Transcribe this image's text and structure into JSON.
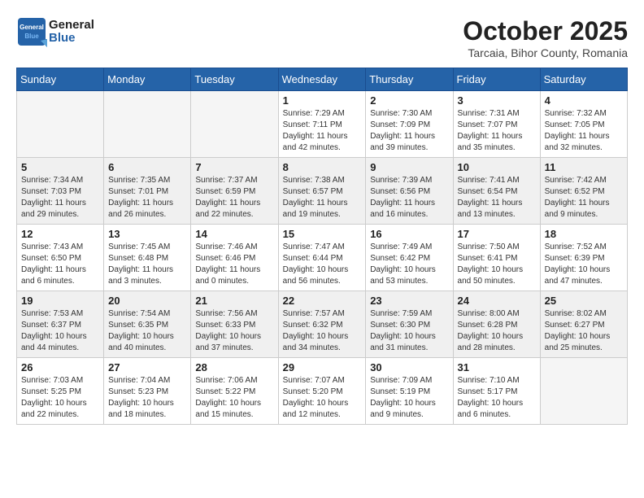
{
  "header": {
    "logo_general": "General",
    "logo_blue": "Blue",
    "month_title": "October 2025",
    "subtitle": "Tarcaia, Bihor County, Romania"
  },
  "weekdays": [
    "Sunday",
    "Monday",
    "Tuesday",
    "Wednesday",
    "Thursday",
    "Friday",
    "Saturday"
  ],
  "weeks": [
    [
      {
        "day": "",
        "info": ""
      },
      {
        "day": "",
        "info": ""
      },
      {
        "day": "",
        "info": ""
      },
      {
        "day": "1",
        "info": "Sunrise: 7:29 AM\nSunset: 7:11 PM\nDaylight: 11 hours\nand 42 minutes."
      },
      {
        "day": "2",
        "info": "Sunrise: 7:30 AM\nSunset: 7:09 PM\nDaylight: 11 hours\nand 39 minutes."
      },
      {
        "day": "3",
        "info": "Sunrise: 7:31 AM\nSunset: 7:07 PM\nDaylight: 11 hours\nand 35 minutes."
      },
      {
        "day": "4",
        "info": "Sunrise: 7:32 AM\nSunset: 7:05 PM\nDaylight: 11 hours\nand 32 minutes."
      }
    ],
    [
      {
        "day": "5",
        "info": "Sunrise: 7:34 AM\nSunset: 7:03 PM\nDaylight: 11 hours\nand 29 minutes."
      },
      {
        "day": "6",
        "info": "Sunrise: 7:35 AM\nSunset: 7:01 PM\nDaylight: 11 hours\nand 26 minutes."
      },
      {
        "day": "7",
        "info": "Sunrise: 7:37 AM\nSunset: 6:59 PM\nDaylight: 11 hours\nand 22 minutes."
      },
      {
        "day": "8",
        "info": "Sunrise: 7:38 AM\nSunset: 6:57 PM\nDaylight: 11 hours\nand 19 minutes."
      },
      {
        "day": "9",
        "info": "Sunrise: 7:39 AM\nSunset: 6:56 PM\nDaylight: 11 hours\nand 16 minutes."
      },
      {
        "day": "10",
        "info": "Sunrise: 7:41 AM\nSunset: 6:54 PM\nDaylight: 11 hours\nand 13 minutes."
      },
      {
        "day": "11",
        "info": "Sunrise: 7:42 AM\nSunset: 6:52 PM\nDaylight: 11 hours\nand 9 minutes."
      }
    ],
    [
      {
        "day": "12",
        "info": "Sunrise: 7:43 AM\nSunset: 6:50 PM\nDaylight: 11 hours\nand 6 minutes."
      },
      {
        "day": "13",
        "info": "Sunrise: 7:45 AM\nSunset: 6:48 PM\nDaylight: 11 hours\nand 3 minutes."
      },
      {
        "day": "14",
        "info": "Sunrise: 7:46 AM\nSunset: 6:46 PM\nDaylight: 11 hours\nand 0 minutes."
      },
      {
        "day": "15",
        "info": "Sunrise: 7:47 AM\nSunset: 6:44 PM\nDaylight: 10 hours\nand 56 minutes."
      },
      {
        "day": "16",
        "info": "Sunrise: 7:49 AM\nSunset: 6:42 PM\nDaylight: 10 hours\nand 53 minutes."
      },
      {
        "day": "17",
        "info": "Sunrise: 7:50 AM\nSunset: 6:41 PM\nDaylight: 10 hours\nand 50 minutes."
      },
      {
        "day": "18",
        "info": "Sunrise: 7:52 AM\nSunset: 6:39 PM\nDaylight: 10 hours\nand 47 minutes."
      }
    ],
    [
      {
        "day": "19",
        "info": "Sunrise: 7:53 AM\nSunset: 6:37 PM\nDaylight: 10 hours\nand 44 minutes."
      },
      {
        "day": "20",
        "info": "Sunrise: 7:54 AM\nSunset: 6:35 PM\nDaylight: 10 hours\nand 40 minutes."
      },
      {
        "day": "21",
        "info": "Sunrise: 7:56 AM\nSunset: 6:33 PM\nDaylight: 10 hours\nand 37 minutes."
      },
      {
        "day": "22",
        "info": "Sunrise: 7:57 AM\nSunset: 6:32 PM\nDaylight: 10 hours\nand 34 minutes."
      },
      {
        "day": "23",
        "info": "Sunrise: 7:59 AM\nSunset: 6:30 PM\nDaylight: 10 hours\nand 31 minutes."
      },
      {
        "day": "24",
        "info": "Sunrise: 8:00 AM\nSunset: 6:28 PM\nDaylight: 10 hours\nand 28 minutes."
      },
      {
        "day": "25",
        "info": "Sunrise: 8:02 AM\nSunset: 6:27 PM\nDaylight: 10 hours\nand 25 minutes."
      }
    ],
    [
      {
        "day": "26",
        "info": "Sunrise: 7:03 AM\nSunset: 5:25 PM\nDaylight: 10 hours\nand 22 minutes."
      },
      {
        "day": "27",
        "info": "Sunrise: 7:04 AM\nSunset: 5:23 PM\nDaylight: 10 hours\nand 18 minutes."
      },
      {
        "day": "28",
        "info": "Sunrise: 7:06 AM\nSunset: 5:22 PM\nDaylight: 10 hours\nand 15 minutes."
      },
      {
        "day": "29",
        "info": "Sunrise: 7:07 AM\nSunset: 5:20 PM\nDaylight: 10 hours\nand 12 minutes."
      },
      {
        "day": "30",
        "info": "Sunrise: 7:09 AM\nSunset: 5:19 PM\nDaylight: 10 hours\nand 9 minutes."
      },
      {
        "day": "31",
        "info": "Sunrise: 7:10 AM\nSunset: 5:17 PM\nDaylight: 10 hours\nand 6 minutes."
      },
      {
        "day": "",
        "info": ""
      }
    ]
  ]
}
